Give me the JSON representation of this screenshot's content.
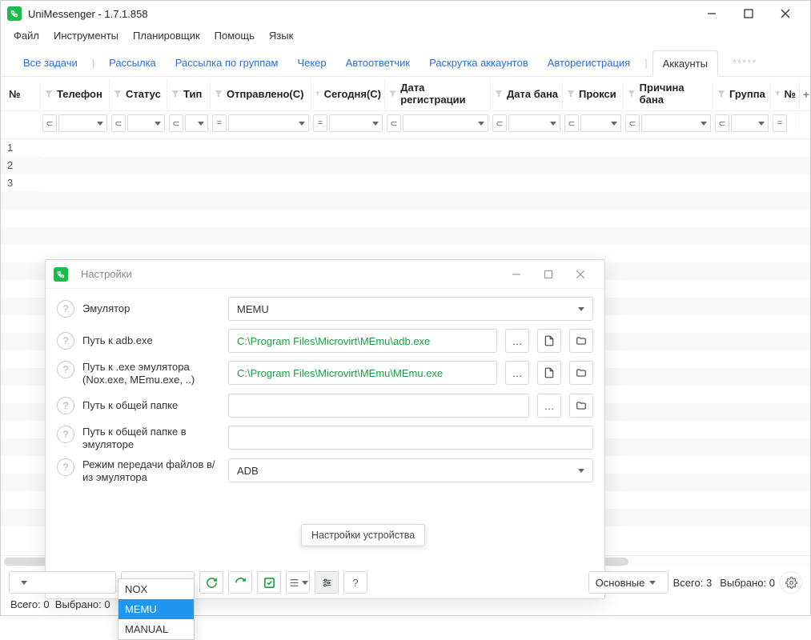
{
  "window": {
    "title": "UniMessenger - 1.7.1.858"
  },
  "menu": {
    "file": "Файл",
    "tools": "Инструменты",
    "scheduler": "Планировщик",
    "help": "Помощь",
    "lang": "Язык"
  },
  "tabs": {
    "all": "Все задачи",
    "broadcast": "Рассылка",
    "group_broadcast": "Рассылка по группам",
    "checker": "Чекер",
    "autoreply": "Автоответчик",
    "promo": "Раскрутка аккаунтов",
    "autoreg": "Авторегистрация",
    "accounts": "Аккаунты"
  },
  "columns": {
    "num": "№",
    "phone": "Телефон",
    "status": "Статус",
    "type": "Тип",
    "sent": "Отправлено(С)",
    "today": "Сегодня(С)",
    "regdate": "Дата регистрации",
    "bandate": "Дата бана",
    "proxy": "Прокси",
    "banreason": "Причина бана",
    "group": "Группа",
    "num2": "№"
  },
  "rows": {
    "r1": "1",
    "r2": "2",
    "r3": "3"
  },
  "modal": {
    "title": "Настройки",
    "emulator_label": "Эмулятор",
    "emulator_value": "MEMU",
    "adb_label": "Путь к adb.exe",
    "adb_value": "C:\\Program Files\\Microvirt\\MEmu\\adb.exe",
    "exe_label": "Путь к .exe эмулятора (Nox.exe, MEmu.exe, ..)",
    "exe_value": "C:\\Program Files\\Microvirt\\MEmu\\MEmu.exe",
    "shared_label": "Путь к общей папке",
    "shared_value": "",
    "shared_emu_label": "Путь к общей папке в эмуляторе",
    "shared_emu_value": "",
    "transfer_label": "Режим передачи файлов в/из эмулятора",
    "transfer_value": "ADB"
  },
  "tooltip": {
    "text": "Настройки устройства"
  },
  "bottom": {
    "emu_dd": "MEMU",
    "category_dd": "Основные",
    "summary_total_label": "Всего:",
    "summary_total_val": "3",
    "summary_sel_label": "Выбрано:",
    "summary_sel_val": "0",
    "status2_total_label": "Всего:",
    "status2_total_val": "0",
    "status2_sel_label": "Выбрано:",
    "status2_sel_val": "0"
  },
  "popup": {
    "opt1": "NOX",
    "opt2": "MEMU",
    "opt3": "MANUAL"
  }
}
